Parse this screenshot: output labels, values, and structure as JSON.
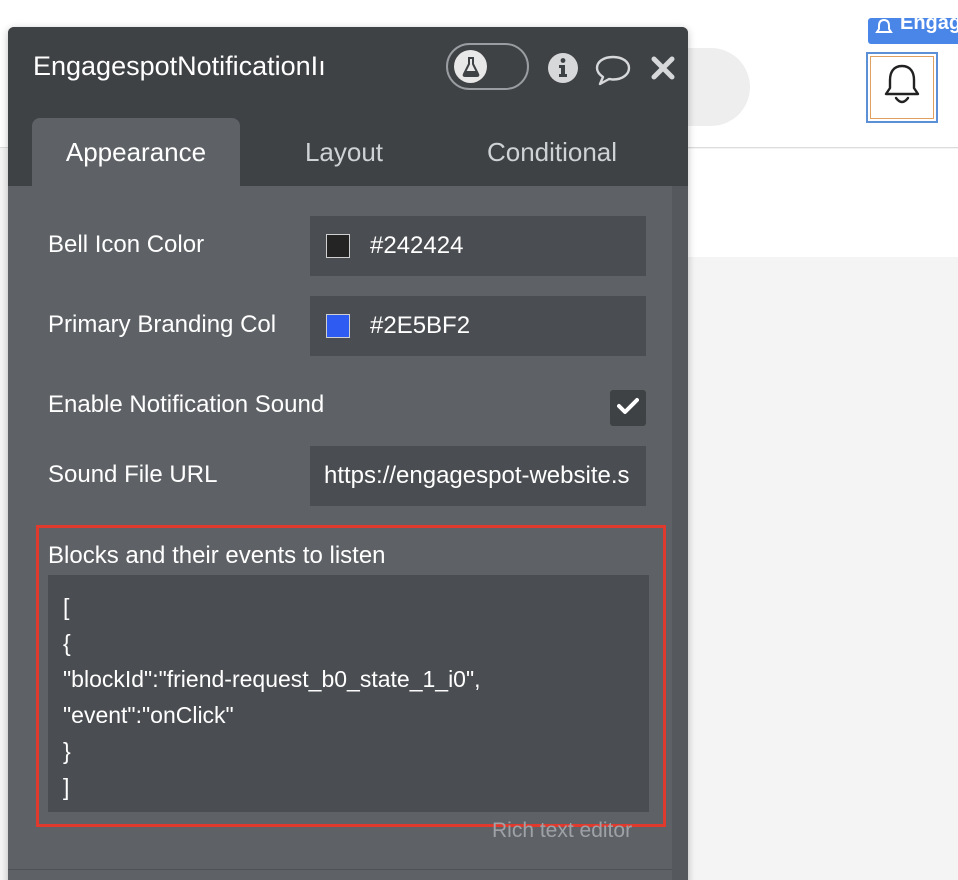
{
  "panel": {
    "title": "EngagespotNotificationIı",
    "tabs": [
      {
        "label": "Appearance",
        "active": true
      },
      {
        "label": "Layout",
        "active": false
      },
      {
        "label": "Conditional",
        "active": false
      }
    ],
    "fields": {
      "bell_icon_color": {
        "label": "Bell Icon Color",
        "value": "#242424",
        "swatch": "#242424"
      },
      "primary_branding": {
        "label": "Primary Branding Col",
        "value": "#2E5BF2",
        "swatch": "#2E5BF2"
      },
      "enable_sound": {
        "label": "Enable Notification Sound",
        "checked": true
      },
      "sound_url": {
        "label": "Sound File URL",
        "value": "https://engagespot-website.s"
      }
    },
    "blocks": {
      "label": "Blocks and their events to listen",
      "code_lines": [
        "[",
        "{",
        "\"blockId\":\"friend-request_b0_state_1_i0\",",
        "\"event\":\"onClick\"",
        "}",
        "]"
      ],
      "editor_label": "Rich text editor"
    }
  },
  "canvas": {
    "element_tag": "Engag"
  },
  "colors": {
    "panel_bg": "#5e6266",
    "header_bg": "#3f4245",
    "field_bg": "#4a4d51",
    "highlight": "#e03a2f",
    "tag_blue": "#4a86e8"
  },
  "icons": {
    "toggle": "flask-icon",
    "info": "info-icon",
    "comment": "comment-icon",
    "close": "close-icon",
    "checkbox": "checkmark-icon",
    "element": "bell-icon"
  }
}
